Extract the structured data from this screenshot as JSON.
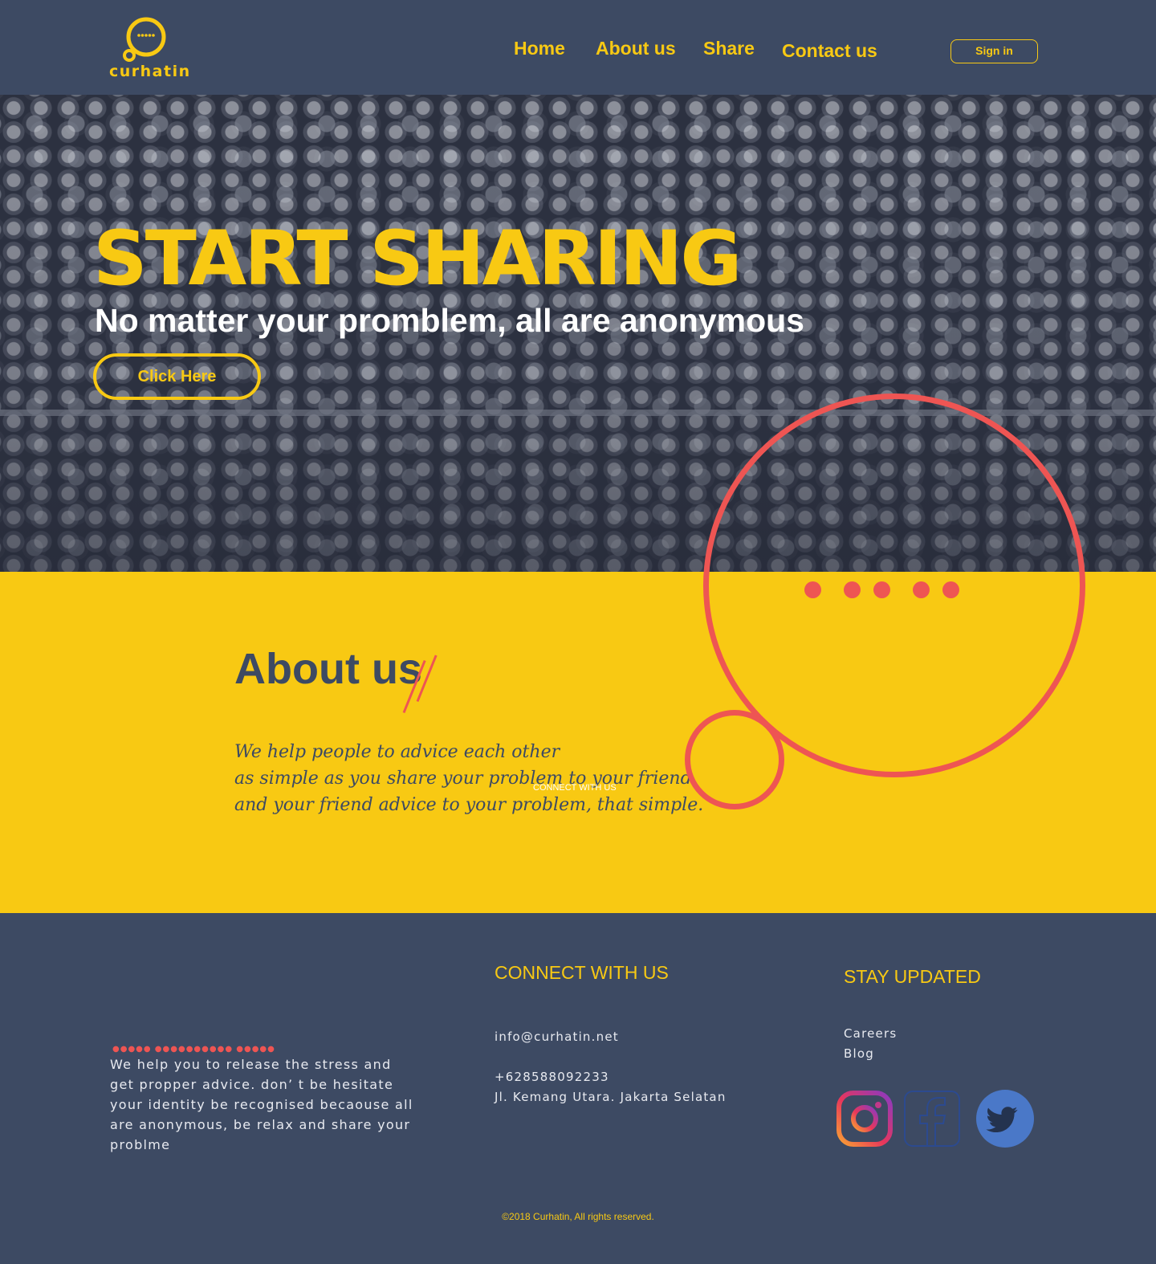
{
  "brand": {
    "name": "curhatin"
  },
  "nav": {
    "home": "Home",
    "about": "About us",
    "share": "Share",
    "contact": "Contact us",
    "signin": "Sign in"
  },
  "hero": {
    "title": "START SHARING",
    "subtitle": "No matter your promblem, all are anonymous",
    "cta": "Click Here"
  },
  "about": {
    "title": "About us",
    "lines": [
      "We help people to advice each other",
      "as simple as you share your problem to your friend",
      "and your friend advice to your problem, that simple."
    ],
    "overlay_text": "CONNECT WITH US"
  },
  "footer": {
    "dots": "●●●●● ●●●●●●●●●● ●●●●●",
    "about_text": "We help you to release the stress and get propper advice. don’ t be hesitate your identity be recognised becaouse all are anonymous, be relax and share your problme",
    "connect": {
      "heading": "CONNECT WITH US",
      "email": "info@curhatin.net",
      "phone": "+628588092233",
      "address": "Jl. Kemang Utara. Jakarta Selatan"
    },
    "updated": {
      "heading": "STAY UPDATED",
      "careers": "Careers",
      "blog": "Blog"
    },
    "social": [
      "instagram-icon",
      "facebook-icon",
      "twitter-icon"
    ],
    "copyright": "©2018 Curhatin, All rights reserved."
  },
  "colors": {
    "navy": "#3d4a63",
    "yellow": "#f8c913",
    "coral": "#ee5553",
    "white": "#ffffff",
    "twitter_blue": "#4a78c8"
  }
}
